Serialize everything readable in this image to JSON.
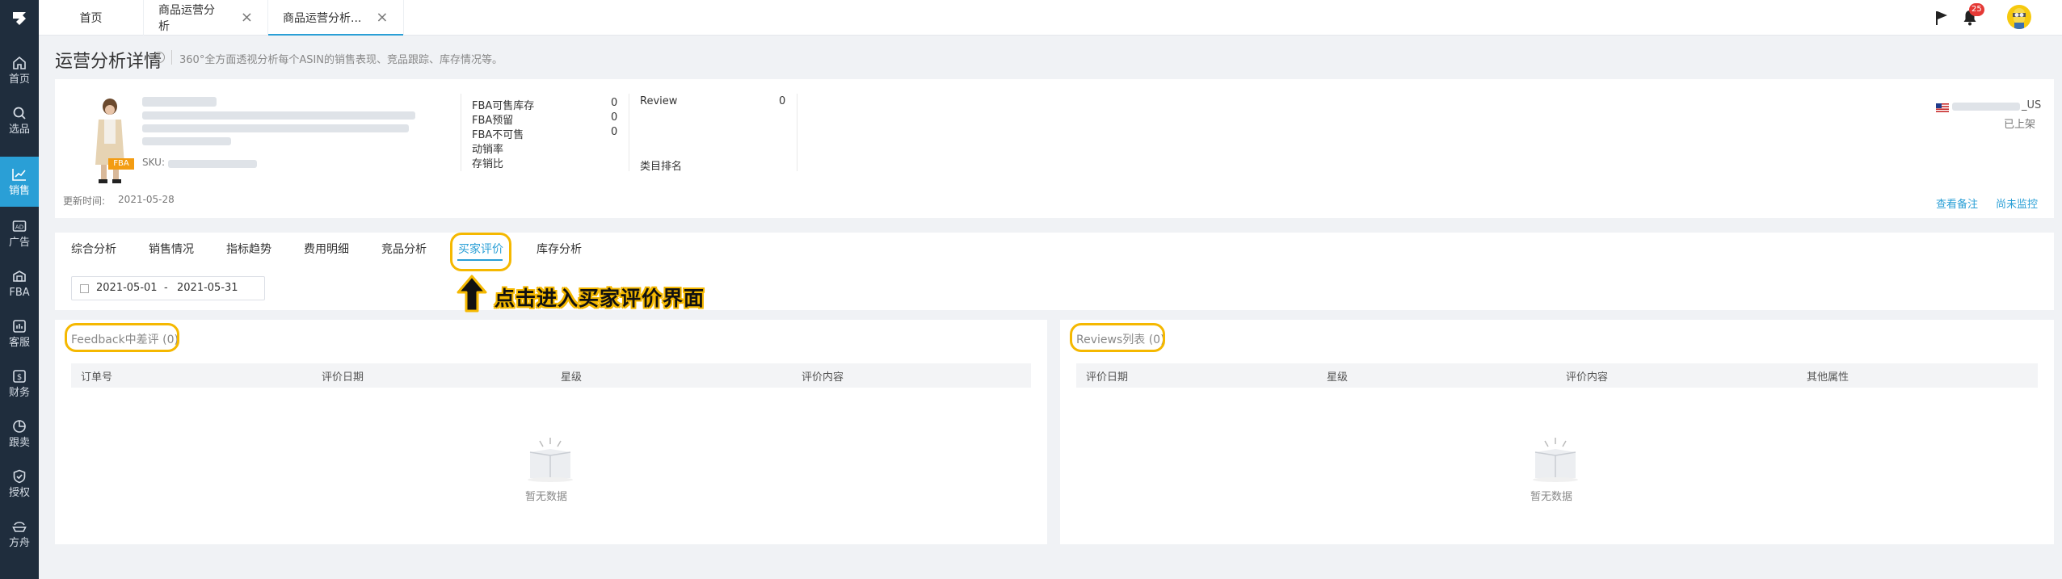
{
  "top_tabs": [
    {
      "label": "首页"
    },
    {
      "label": "商品运营分析"
    },
    {
      "label": "商品运营分析..."
    }
  ],
  "header": {
    "notification_count": "25"
  },
  "sidebar": {
    "items": [
      {
        "label": "首页",
        "icon": "home-icon"
      },
      {
        "label": "选品",
        "icon": "search-icon"
      },
      {
        "label": "销售",
        "icon": "chart-line-icon"
      },
      {
        "label": "广告",
        "icon": "ad-icon"
      },
      {
        "label": "FBA",
        "icon": "warehouse-icon"
      },
      {
        "label": "客服",
        "icon": "service-icon"
      },
      {
        "label": "财务",
        "icon": "finance-icon"
      },
      {
        "label": "跟卖",
        "icon": "pie-icon"
      },
      {
        "label": "授权",
        "icon": "shield-icon"
      },
      {
        "label": "方舟",
        "icon": "ark-icon"
      }
    ]
  },
  "page": {
    "title": "运营分析详情",
    "description": "360°全方面透视分析每个ASIN的销售表现、竞品跟踪、库存情况等。"
  },
  "product": {
    "fulfillment_badge": "FBA",
    "sku_label": "SKU:",
    "metrics": [
      {
        "label": "FBA可售库存",
        "value": "0"
      },
      {
        "label": "FBA预留",
        "value": "0"
      },
      {
        "label": "FBA不可售",
        "value": "0"
      },
      {
        "label": "动销率",
        "value": ""
      },
      {
        "label": "存销比",
        "value": ""
      }
    ],
    "review_label": "Review",
    "review_value": "0",
    "category_rank_label": "类目排名",
    "store_suffix": "_US",
    "listing_status": "已上架",
    "update_time_label": "更新时间:",
    "update_time_value": "2021-05-28",
    "view_notes_link": "查看备注",
    "monitor_link": "尚未监控"
  },
  "analysis_tabs": [
    {
      "label": "综合分析"
    },
    {
      "label": "销售情况"
    },
    {
      "label": "指标趋势"
    },
    {
      "label": "费用明细"
    },
    {
      "label": "竞品分析"
    },
    {
      "label": "买家评价"
    },
    {
      "label": "库存分析"
    }
  ],
  "active_analysis_tab": "买家评价",
  "date_range": {
    "start": "2021-05-01",
    "separator": "-",
    "end": "2021-05-31"
  },
  "annotation": "点击进入买家评价界面",
  "feedback_panel": {
    "title": "Feedback中差评 (0)",
    "columns": [
      "订单号",
      "评价日期",
      "星级",
      "评价内容"
    ],
    "empty_text": "暂无数据"
  },
  "reviews_panel": {
    "title": "Reviews列表 (0)",
    "columns": [
      "评价日期",
      "星级",
      "评价内容",
      "其他属性"
    ],
    "empty_text": "暂无数据"
  },
  "colors": {
    "accent": "#2a9fd6",
    "highlight": "#f5b800",
    "sidebar": "#1f2d3d",
    "fba_badge": "#f39c12"
  }
}
